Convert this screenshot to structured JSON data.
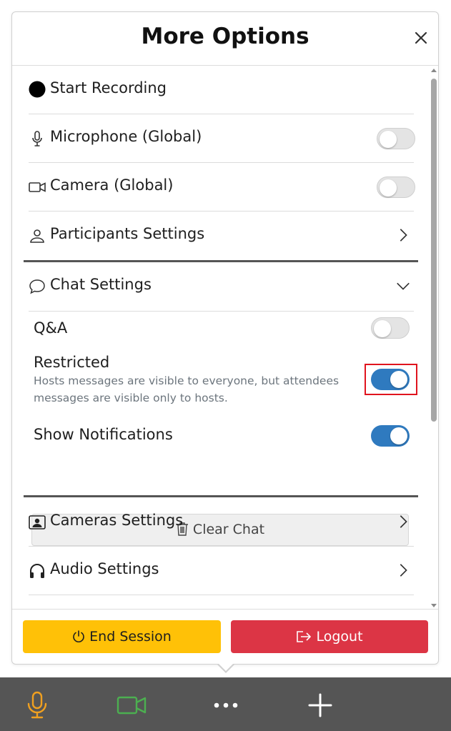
{
  "header": {
    "title": "More Options"
  },
  "menu": {
    "start_recording": "Start Recording",
    "microphone": "Microphone (Global)",
    "camera": "Camera (Global)",
    "participants": "Participants Settings",
    "chat": "Chat Settings",
    "cameras_settings": "Cameras Settings",
    "audio_settings": "Audio Settings"
  },
  "toggles": {
    "microphone_global": false,
    "camera_global": false,
    "qa": false,
    "restricted": true,
    "show_notifications": true
  },
  "chat_settings": {
    "qa_label": "Q&A",
    "restricted_label": "Restricted",
    "restricted_desc_line1": "Hosts messages are visible to everyone, but attendees",
    "restricted_desc_line2": "messages are visible only to hosts.",
    "notifications_label": "Show Notifications",
    "clear_chat_label": "Clear Chat"
  },
  "footer": {
    "end_session_label": "End Session",
    "logout_label": "Logout"
  },
  "colors": {
    "toggle_on": "#2f7abf",
    "end_session": "#ffc107",
    "logout": "#dc3545",
    "mic_icon": "#f0a020",
    "camera_icon": "#4caf50",
    "bottom_bar": "#555555",
    "highlight": "#e0141e"
  }
}
